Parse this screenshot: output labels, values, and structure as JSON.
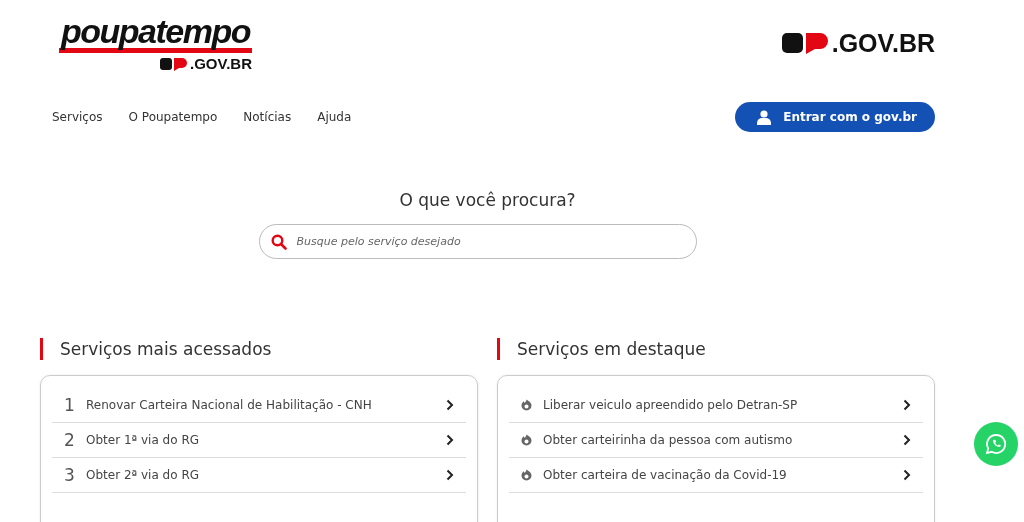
{
  "header": {
    "logo_word": "poupatempo",
    "logo_sub": ".GOV.BR",
    "gov_logo": ".GOV.BR"
  },
  "nav": [
    {
      "label": "Serviços"
    },
    {
      "label": "O Poupatempo"
    },
    {
      "label": "Notícias"
    },
    {
      "label": "Ajuda"
    }
  ],
  "login_button": "Entrar com o gov.br",
  "search": {
    "heading": "O que você procura?",
    "placeholder": "Busque pelo serviço desejado"
  },
  "sections": [
    {
      "title": "Serviços mais acessados",
      "kind": "numbered",
      "items": [
        {
          "number": "1",
          "label": "Renovar Carteira Nacional de Habilitação - CNH"
        },
        {
          "number": "2",
          "label": "Obter 1ª via do RG"
        },
        {
          "number": "3",
          "label": "Obter 2ª via do RG"
        }
      ]
    },
    {
      "title": "Serviços em destaque",
      "kind": "featured",
      "items": [
        {
          "label": "Liberar veiculo apreendido pelo Detran-SP"
        },
        {
          "label": "Obter carteirinha da pessoa com autismo"
        },
        {
          "label": "Obter carteira de vacinação da Covid-19"
        }
      ]
    }
  ]
}
